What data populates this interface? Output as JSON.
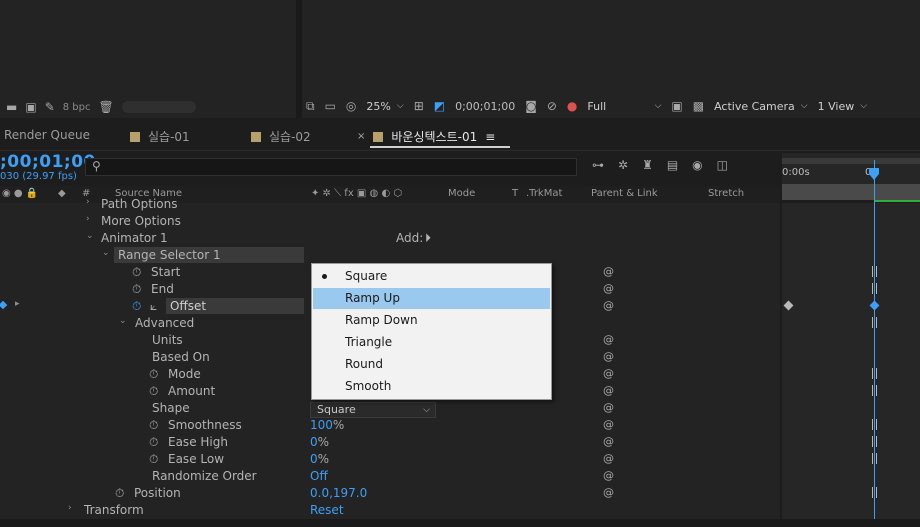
{
  "project_toolbar": {
    "bpc_label": "8 bpc"
  },
  "comp_toolbar": {
    "zoom": "25%",
    "timecode": "0;00;01;00",
    "resolution": "Full",
    "camera": "Active Camera",
    "view": "1 View"
  },
  "tabs": [
    {
      "label": "Render Queue"
    },
    {
      "label": "실습-01"
    },
    {
      "label": "실습-02"
    },
    {
      "label": "바운싱텍스트-01"
    }
  ],
  "timeline": {
    "timecode": ";00;01;00",
    "fps": "030 (29.97 fps)",
    "ruler_start": "0:00s",
    "ruler_cti": "0s"
  },
  "columns": {
    "source_name": "Source Name",
    "mode": "Mode",
    "t": "T",
    "trkmat": ".TrkMat",
    "parent": "Parent & Link",
    "stretch": "Stretch"
  },
  "layers": {
    "path_options": "Path Options",
    "more_options": "More Options",
    "animator": "Animator 1",
    "add_label": "Add:",
    "range_selector": "Range Selector 1",
    "start": "Start",
    "end": "End",
    "offset": "Offset",
    "advanced": "Advanced",
    "units": "Units",
    "based_on": "Based On",
    "mode": "Mode",
    "amount": "Amount",
    "shape": "Shape",
    "shape_value": "Square",
    "smoothness": "Smoothness",
    "smoothness_value": "100",
    "ease_high": "Ease High",
    "ease_high_value": "0",
    "ease_low": "Ease Low",
    "ease_low_value": "0",
    "percent": "%",
    "randomize_order": "Randomize Order",
    "randomize_value": "Off",
    "position": "Position",
    "position_value": "0.0,197.0",
    "transform": "Transform",
    "transform_value": "Reset"
  },
  "shape_dropdown": {
    "options": [
      "Square",
      "Ramp Up",
      "Ramp Down",
      "Triangle",
      "Round",
      "Smooth"
    ],
    "checked": "Square",
    "highlighted": "Ramp Up"
  },
  "colors": {
    "accent": "#3d9ff5",
    "highlight": "#99c9ef",
    "keyframe_green": "#2fae3f"
  }
}
